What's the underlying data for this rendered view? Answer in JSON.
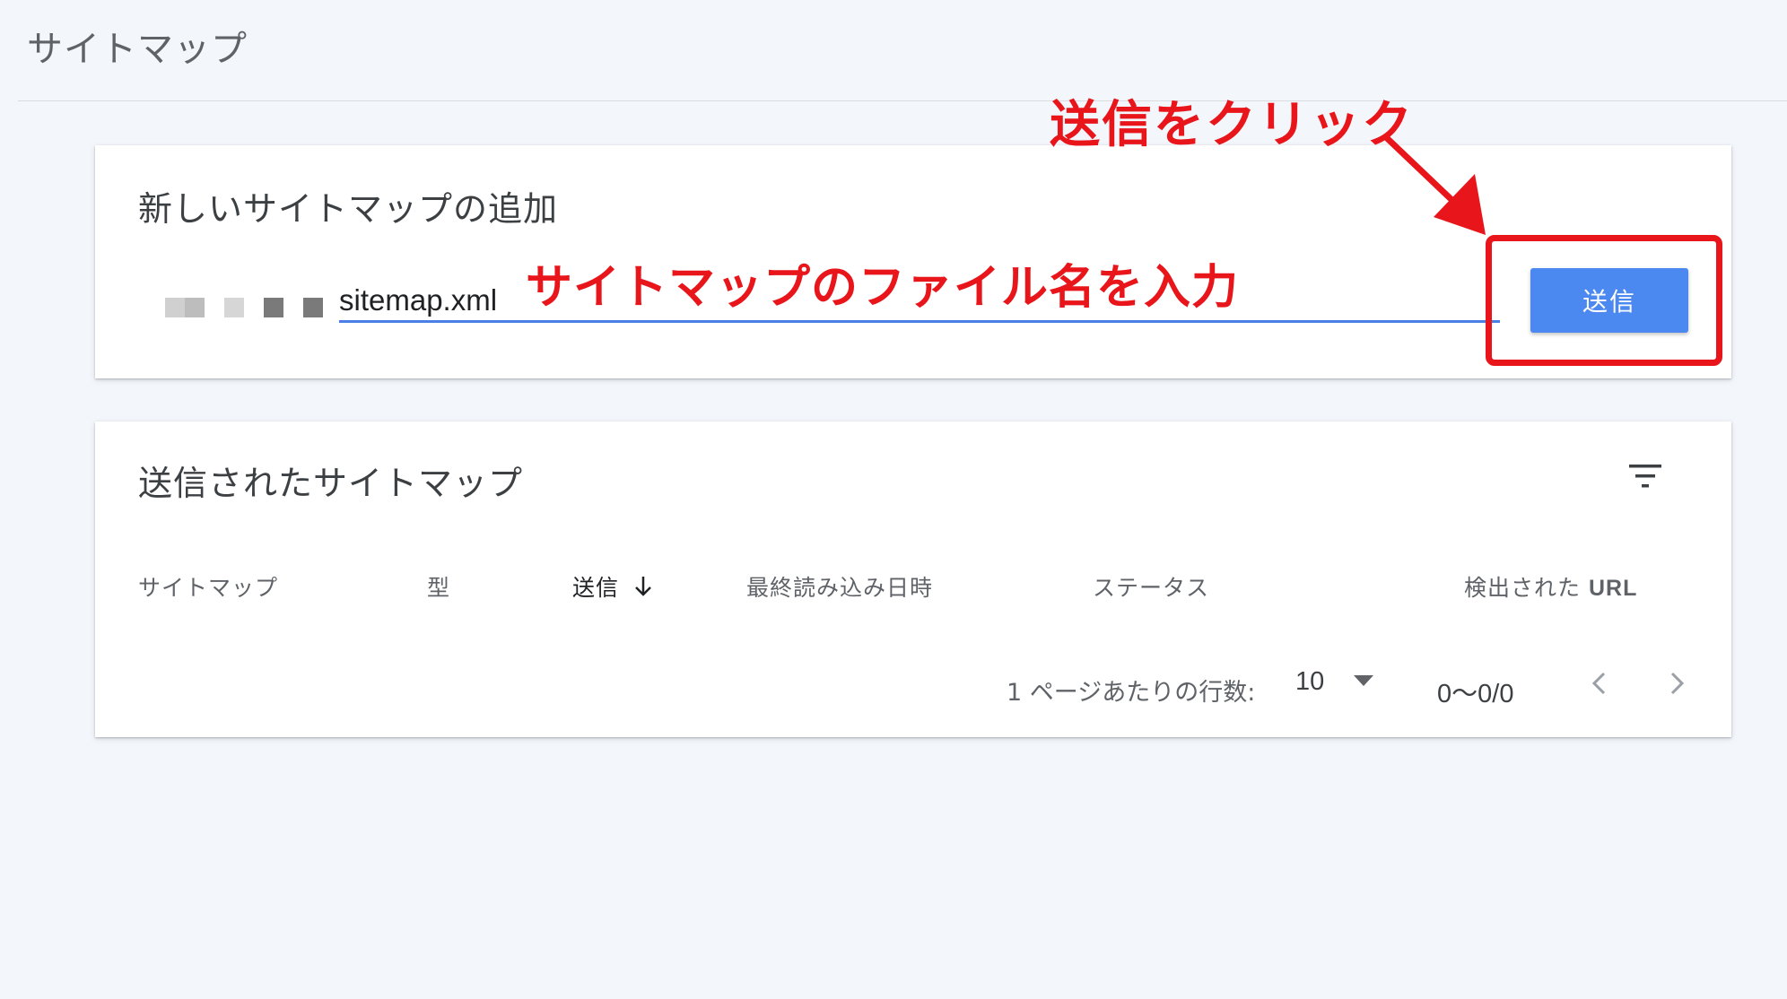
{
  "page": {
    "title": "サイトマップ"
  },
  "add_card": {
    "heading": "新しいサイトマップの追加",
    "input_value": "sitemap.xml",
    "submit_label": "送信"
  },
  "list_card": {
    "heading": "送信されたサイトマップ",
    "columns": {
      "sitemap": "サイトマップ",
      "type": "型",
      "submitted": "送信",
      "last_read": "最終読み込み日時",
      "status": "ステータス",
      "discovered_prefix": "検出された",
      "discovered_url": "URL"
    },
    "pagination": {
      "rows_per_page_label": "1 ページあたりの行数:",
      "rows_per_page_value": "10",
      "range": "0〜0/0"
    }
  },
  "annotations": {
    "click_submit": "送信をクリック",
    "enter_filename": "サイトマップのファイル名を入力"
  },
  "colors": {
    "accent": "#4b89f0",
    "underline": "#4a80e6",
    "annotation": "#e8161b",
    "background": "#f3f6fb"
  },
  "icons": [
    "filter-icon",
    "sort-arrow-down-icon",
    "dropdown-triangle-icon",
    "chevron-left-icon",
    "chevron-right-icon"
  ]
}
